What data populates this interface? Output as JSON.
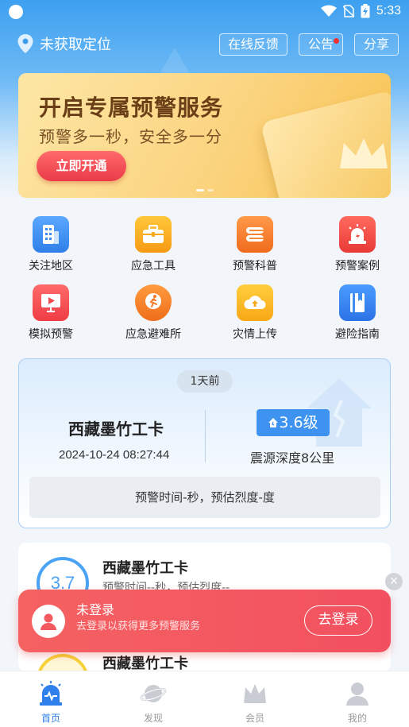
{
  "status_bar": {
    "time": "5:33"
  },
  "header": {
    "location_text": "未获取定位",
    "feedback_label": "在线反馈",
    "notice_label": "公告",
    "share_label": "分享"
  },
  "banner": {
    "title": "开启专属预警服务",
    "subtitle": "预警多一秒，安全多一分",
    "cta_label": "立即开通"
  },
  "shortcuts": [
    {
      "label": "关注地区",
      "icon": "building-icon"
    },
    {
      "label": "应急工具",
      "icon": "toolbox-icon"
    },
    {
      "label": "预警科普",
      "icon": "book-stack-icon"
    },
    {
      "label": "预警案例",
      "icon": "alarm-light-icon"
    },
    {
      "label": "模拟预警",
      "icon": "play-screen-icon"
    },
    {
      "label": "应急避难所",
      "icon": "running-person-icon"
    },
    {
      "label": "灾情上传",
      "icon": "cloud-upload-icon"
    },
    {
      "label": "避险指南",
      "icon": "guide-book-icon"
    }
  ],
  "quake_card": {
    "time_ago": "1天前",
    "location": "西藏墨竹工卡",
    "datetime": "2024-10-24 08:27:44",
    "magnitude": "3.6级",
    "depth": "震源深度8公里",
    "warning": "预警时间-秒，预估烈度-度"
  },
  "event_list": [
    {
      "magnitude": "3.7",
      "location": "西藏墨竹工卡",
      "detail": "预警时间--秒，预估烈度--"
    },
    {
      "location": "西藏墨竹工卡"
    }
  ],
  "login_toast": {
    "title": "未登录",
    "subtitle": "去登录以获得更多预警服务",
    "button_label": "去登录",
    "close_glyph": "✕"
  },
  "bottom_nav": [
    {
      "label": "首页",
      "active": true
    },
    {
      "label": "发现",
      "active": false
    },
    {
      "label": "会员",
      "active": false
    },
    {
      "label": "我的",
      "active": false
    }
  ],
  "colors": {
    "primary": "#2f80ed",
    "toast": "#f25a5f",
    "banner_cta": "#ea3a48"
  }
}
